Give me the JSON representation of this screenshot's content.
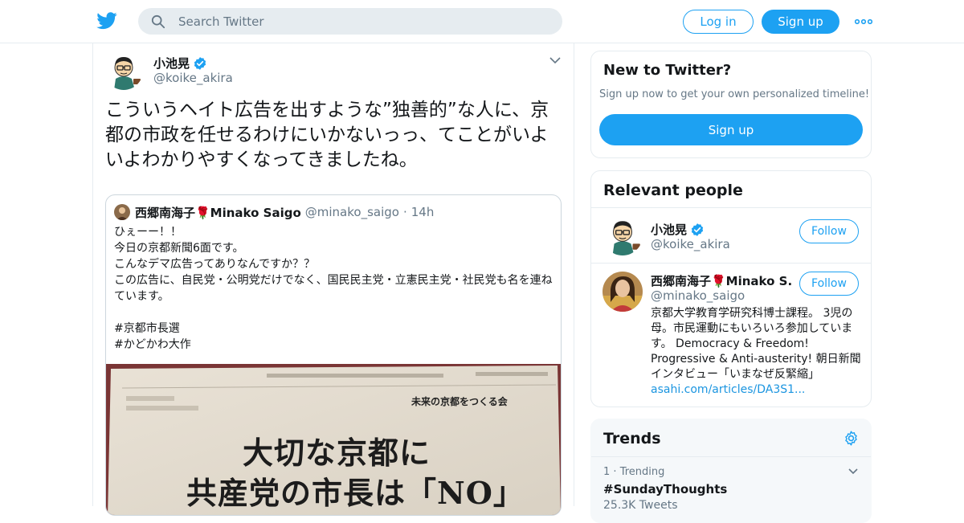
{
  "header": {
    "search_placeholder": "Search Twitter",
    "login_label": "Log in",
    "signup_label": "Sign up"
  },
  "tweet": {
    "author_name": "小池晃",
    "author_handle": "@koike_akira",
    "text": "こういうヘイト広告を出すような”独善的”な人に、京都の市政を任せるわけにいかないっっ、てことがいよいよわかりやすくなってきましたね。",
    "quote": {
      "author_name": "西郷南海子🌹Minako Saigo",
      "author_handle": "@minako_saigo",
      "separator": "·",
      "time": "14h",
      "text": "ひぇーー！！\n今日の京都新聞6面です。\nこんなデマ広告ってありなんですか？？\nこの広告に、自民党・公明党だけでなく、国民民主党・立憲民主党・社民党も名を連ねています。\n\n#京都市長選\n#かどかわ大作",
      "image_headline_1": "大切な京都に",
      "image_headline_2": "共産党の市長は「NO」",
      "image_masthead": "未来の京都をつくる会"
    }
  },
  "new_to_twitter": {
    "title": "New to Twitter?",
    "subtitle": "Sign up now to get your own personalized timeline!",
    "signup_label": "Sign up"
  },
  "relevant_people": {
    "title": "Relevant people",
    "people": [
      {
        "name": "小池晃",
        "handle": "@koike_akira",
        "follow_label": "Follow"
      },
      {
        "name": "西郷南海子🌹Minako S...",
        "handle": "@minako_saigo",
        "follow_label": "Follow",
        "bio": "京都大学教育学研究科博士課程。 3児の母。市民運動にもいろいろ参加しています。 Democracy & Freedom! Progressive & Anti-austerity! 朝日新聞インタビュー「いまなぜ反緊縮」",
        "bio_link": "asahi.com/articles/DA3S1..."
      }
    ]
  },
  "trends": {
    "title": "Trends",
    "items": [
      {
        "rank": "1",
        "separator": "·",
        "category": "Trending",
        "name": "#SundayThoughts",
        "count": "25.3K Tweets"
      }
    ]
  },
  "colors": {
    "accent": "#1da1f2",
    "muted": "#657786",
    "border": "#e6ecf0"
  }
}
